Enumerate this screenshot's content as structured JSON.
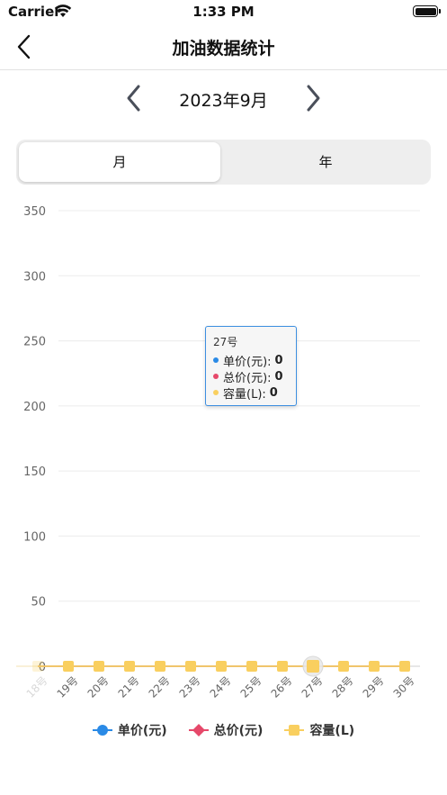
{
  "status": {
    "carrier": "Carrier",
    "time": "1:33 PM"
  },
  "nav": {
    "title": "加油数据统计"
  },
  "month_switch": {
    "label": "2023年9月"
  },
  "segment": {
    "month": "月",
    "year": "年",
    "selected": "月"
  },
  "colors": {
    "price": "#2a8ae6",
    "total": "#e6486a",
    "volume": "#f9cf5f",
    "tooltip_border": "#3d8fe0"
  },
  "chart_data": {
    "type": "line",
    "categories": [
      "18号",
      "19号",
      "20号",
      "21号",
      "22号",
      "23号",
      "24号",
      "25号",
      "26号",
      "27号",
      "28号",
      "29号",
      "30号"
    ],
    "series": [
      {
        "name": "单价(元)",
        "values": [
          0,
          0,
          0,
          0,
          0,
          0,
          0,
          0,
          0,
          0,
          0,
          0,
          0
        ]
      },
      {
        "name": "总价(元)",
        "values": [
          0,
          0,
          0,
          0,
          0,
          0,
          0,
          0,
          0,
          0,
          0,
          0,
          0
        ]
      },
      {
        "name": "容量(L)",
        "values": [
          0,
          0,
          0,
          0,
          0,
          0,
          0,
          0,
          0,
          0,
          0,
          0,
          0
        ]
      }
    ],
    "ylim": [
      0,
      350
    ],
    "yticks": [
      0,
      50,
      100,
      150,
      200,
      250,
      300,
      350
    ],
    "grid": true,
    "legend": "bottom",
    "highlight_index": 9
  },
  "tooltip": {
    "title": "27号",
    "rows": [
      {
        "label": "单价(元):",
        "value": "0"
      },
      {
        "label": "总价(元):",
        "value": "0"
      },
      {
        "label": "容量(L):",
        "value": "0"
      }
    ]
  },
  "legend": {
    "items": [
      {
        "label": "单价(元)",
        "icon": "circle-marker-icon"
      },
      {
        "label": "总价(元)",
        "icon": "diamond-marker-icon"
      },
      {
        "label": "容量(L)",
        "icon": "square-marker-icon"
      }
    ]
  }
}
